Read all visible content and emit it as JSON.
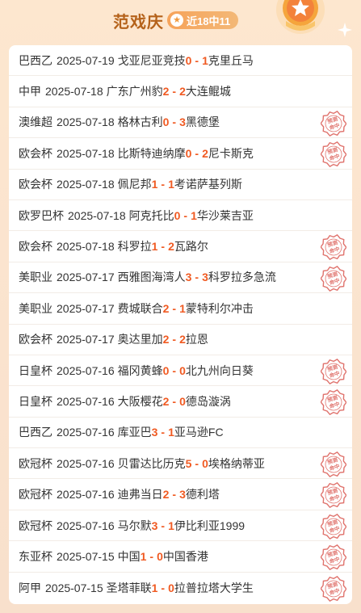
{
  "header": {
    "expert_name": "范戏庆",
    "record": "近18中11",
    "star_glyph": "★"
  },
  "stamp_text": [
    "预测",
    "命中"
  ],
  "colors": {
    "score": "#f05a22",
    "stamp": "#e0736d",
    "title": "#b5621a"
  },
  "matches": [
    {
      "league": "巴西乙",
      "date": "2025-07-19",
      "home": "戈亚尼亚竞技",
      "home_score": "0",
      "away_score": "1",
      "away": "克里丘马",
      "hit": false
    },
    {
      "league": "中甲",
      "date": "2025-07-18",
      "home": "广东广州豹",
      "home_score": "2",
      "away_score": "2",
      "away": "大连鲲城",
      "hit": false
    },
    {
      "league": "澳维超",
      "date": "2025-07-18",
      "home": "格林古利",
      "home_score": "0",
      "away_score": "3",
      "away": "黑德堡",
      "hit": true
    },
    {
      "league": "欧会杯",
      "date": "2025-07-18",
      "home": "比斯特迪纳摩",
      "home_score": "0",
      "away_score": "2",
      "away": "尼卡斯克",
      "hit": true
    },
    {
      "league": "欧会杯",
      "date": "2025-07-18",
      "home": "佩尼邦",
      "home_score": "1",
      "away_score": "1",
      "away": "考诺萨基列斯",
      "hit": false
    },
    {
      "league": "欧罗巴杯",
      "date": "2025-07-18",
      "home": "阿克托比",
      "home_score": "0",
      "away_score": "1",
      "away": "华沙莱吉亚",
      "hit": false
    },
    {
      "league": "欧会杯",
      "date": "2025-07-18",
      "home": "科罗拉",
      "home_score": "1",
      "away_score": "2",
      "away": "瓦路尔",
      "hit": true
    },
    {
      "league": "美职业",
      "date": "2025-07-17",
      "home": "西雅图海湾人",
      "home_score": "3",
      "away_score": "3",
      "away": "科罗拉多急流",
      "hit": true
    },
    {
      "league": "美职业",
      "date": "2025-07-17",
      "home": "费城联合",
      "home_score": "2",
      "away_score": "1",
      "away": "蒙特利尔冲击",
      "hit": false
    },
    {
      "league": "欧会杯",
      "date": "2025-07-17",
      "home": "奥达里加",
      "home_score": "2",
      "away_score": "2",
      "away": "拉恩",
      "hit": false
    },
    {
      "league": "日皇杯",
      "date": "2025-07-16",
      "home": "福冈黄蜂",
      "home_score": "0",
      "away_score": "0",
      "away": "北九州向日葵",
      "hit": true
    },
    {
      "league": "日皇杯",
      "date": "2025-07-16",
      "home": "大阪樱花",
      "home_score": "2",
      "away_score": "0",
      "away": "德岛漩涡",
      "hit": true
    },
    {
      "league": "巴西乙",
      "date": "2025-07-16",
      "home": "库亚巴",
      "home_score": "3",
      "away_score": "1",
      "away": "亚马逊FC",
      "hit": false
    },
    {
      "league": "欧冠杯",
      "date": "2025-07-16",
      "home": "贝雷达比历克",
      "home_score": "5",
      "away_score": "0",
      "away": "埃格纳蒂亚",
      "hit": true
    },
    {
      "league": "欧冠杯",
      "date": "2025-07-16",
      "home": "迪弗当日",
      "home_score": "2",
      "away_score": "3",
      "away": "德利塔",
      "hit": true
    },
    {
      "league": "欧冠杯",
      "date": "2025-07-16",
      "home": "马尔默",
      "home_score": "3",
      "away_score": "1",
      "away": "伊比利亚1999",
      "hit": true
    },
    {
      "league": "东亚杯",
      "date": "2025-07-15",
      "home": "中国",
      "home_score": "1",
      "away_score": "0",
      "away": "中国香港",
      "hit": true
    },
    {
      "league": "阿甲",
      "date": "2025-07-15",
      "home": "圣塔菲联",
      "home_score": "1",
      "away_score": "0",
      "away": "拉普拉塔大学生",
      "hit": true
    }
  ]
}
